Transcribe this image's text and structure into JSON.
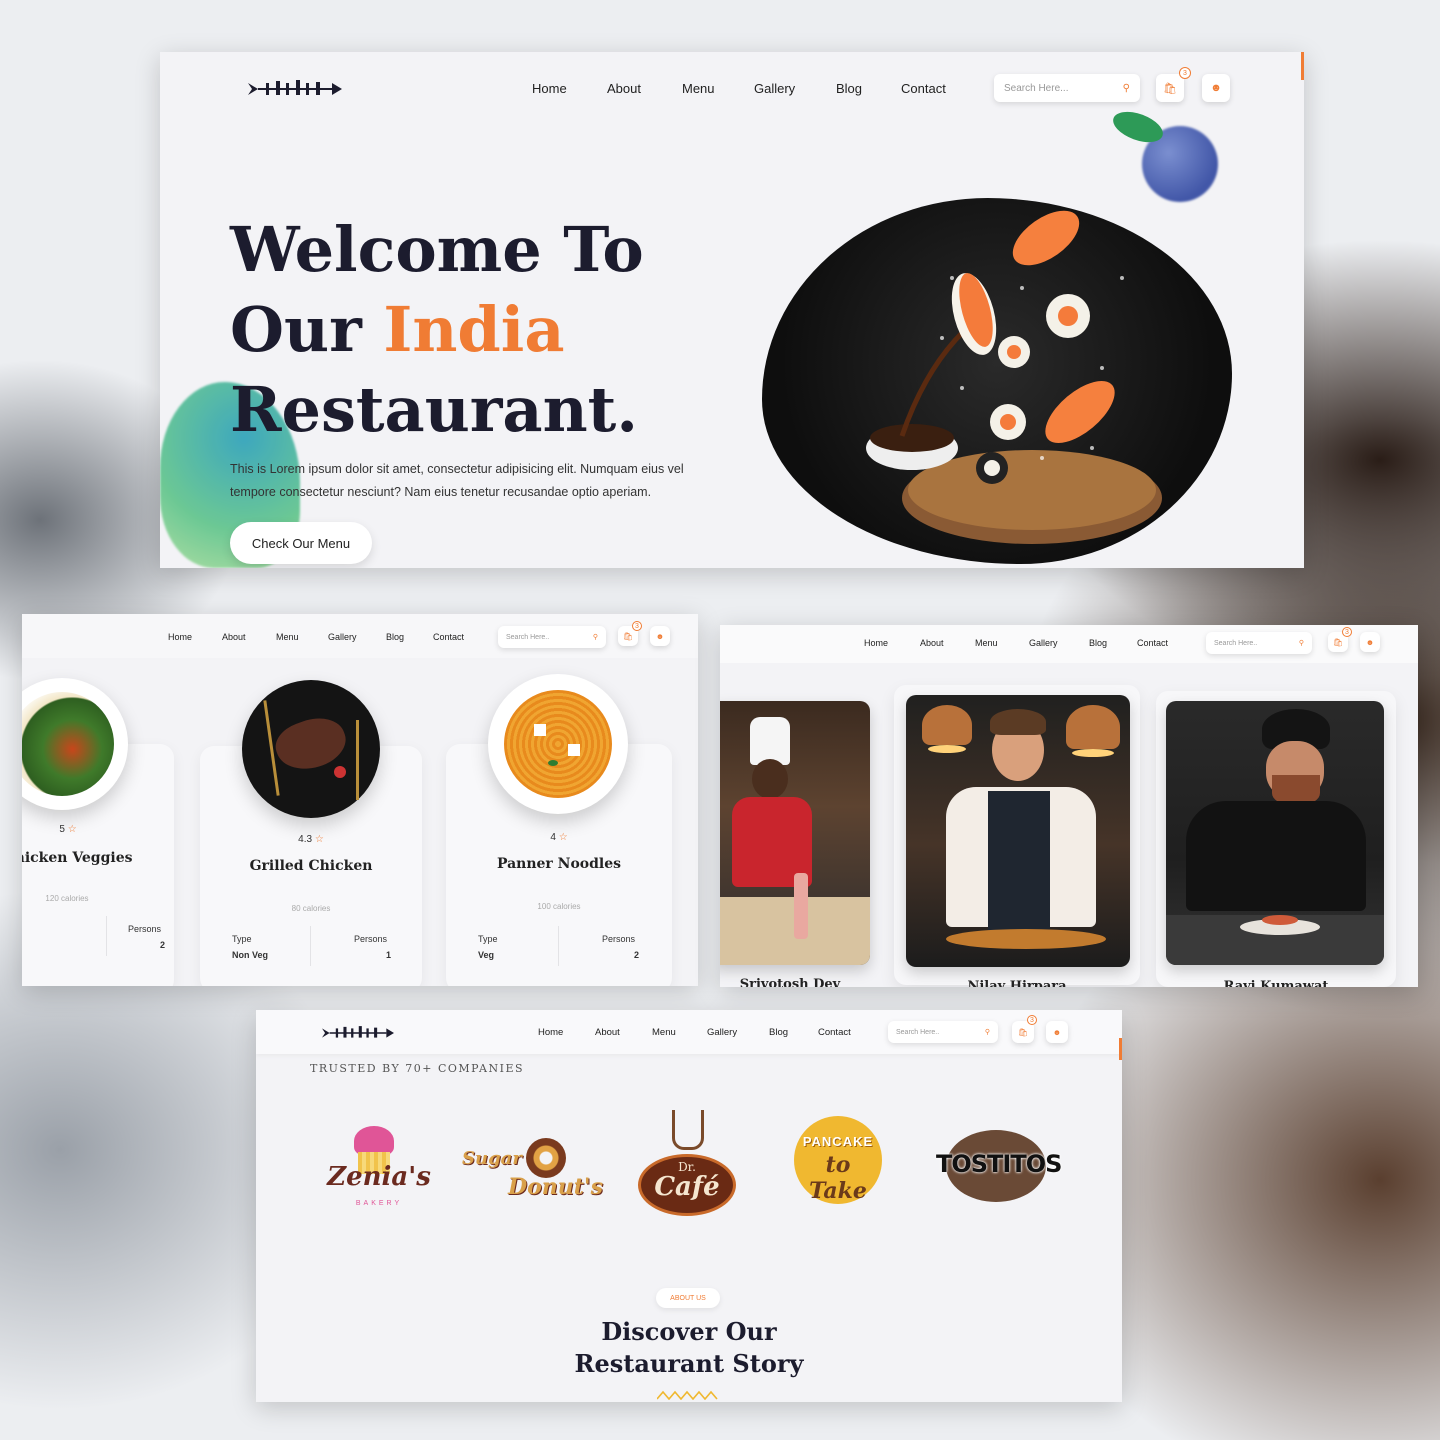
{
  "nav": {
    "items": [
      "Home",
      "About",
      "Menu",
      "Gallery",
      "Blog",
      "Contact"
    ],
    "search_placeholder": "Search Here...",
    "search_placeholder_short": "Search Here..",
    "cart_count": "3"
  },
  "hero": {
    "title_line1": "Welcome To",
    "title_line2_a": "Our ",
    "title_line2_b": "India",
    "title_line3": "Restaurant.",
    "desc_line1": "This is Lorem ipsum dolor sit amet, consectetur adipisicing elit. Numquam eius vel",
    "desc_line2": "tempore consectetur nesciunt? Nam eius tenetur recusandae optio aperiam.",
    "cta": "Check Our Menu"
  },
  "menu": {
    "items": [
      {
        "rating": "5",
        "name": "Chicken Veggies",
        "calories": "120 calories",
        "persons_label": "Persons",
        "persons": "2"
      },
      {
        "rating": "4.3",
        "name": "Grilled Chicken",
        "calories": "80 calories",
        "type_label": "Type",
        "type": "Non Veg",
        "persons_label": "Persons",
        "persons": "1"
      },
      {
        "rating": "4",
        "name": "Panner Noodles",
        "calories": "100 calories",
        "type_label": "Type",
        "type": "Veg",
        "persons_label": "Persons",
        "persons": "2"
      }
    ]
  },
  "chefs": {
    "names": [
      "Srivotosh Dev",
      "Nilay Hirpara",
      "Ravi Kumawat"
    ]
  },
  "trusted": {
    "heading": "TRUSTED BY 70+ COMPANIES",
    "brands": [
      "Zenia's",
      "BAKERY",
      "Sugar",
      "Donut's",
      "Dr.",
      "Café",
      "PANCAKE",
      "to Take",
      "TOSTITOS"
    ]
  },
  "about": {
    "badge": "ABOUT US",
    "title_line1": "Discover Our",
    "title_line2": "Restaurant Story"
  },
  "colors": {
    "accent": "#f07c34",
    "dark": "#1c1c2e",
    "panel": "#f3f3f6"
  }
}
